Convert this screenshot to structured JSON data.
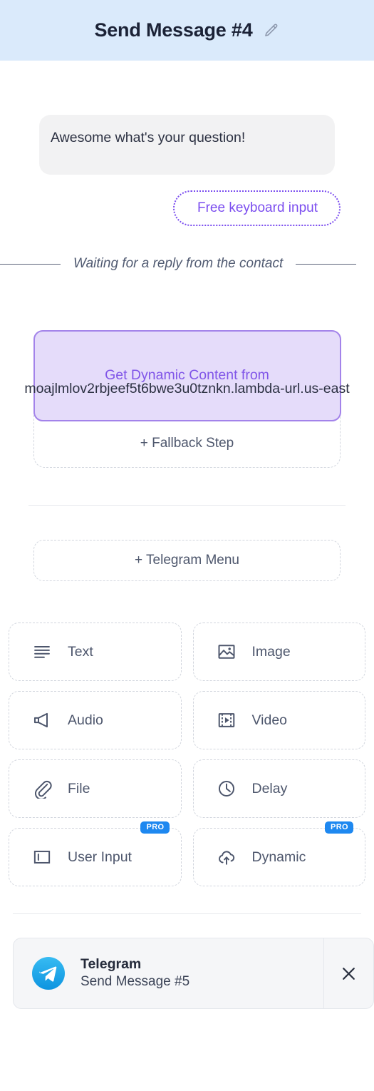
{
  "header": {
    "title": "Send Message #4",
    "edit_icon": "pencil-icon"
  },
  "conversation": {
    "message_text": "Awesome what's your question!",
    "keyboard_pill_label": "Free keyboard input",
    "waiting_divider_text": "Waiting for a reply from the contact"
  },
  "dynamic_card": {
    "title": "Get Dynamic Content from",
    "url": "https://moajlmlov2rbjeef5t6bwe3u0tznkn.lambda-url.us-east-1.on.aws/",
    "url_visible": "moajlmlov2rbjeef5t6bwe3u0tznkn.lambda-url.us-east",
    "fallback_label": "+ Fallback Step",
    "fill_color": "#e5dcfa",
    "border_color": "#a383ea",
    "text_color": "#8055e8"
  },
  "telegram_menu": {
    "label": "+ Telegram Menu"
  },
  "action_grid": {
    "items": [
      {
        "label": "Text",
        "icon": "text-lines-icon",
        "pro": false
      },
      {
        "label": "Image",
        "icon": "image-icon",
        "pro": false
      },
      {
        "label": "Audio",
        "icon": "speaker-icon",
        "pro": false
      },
      {
        "label": "Video",
        "icon": "film-play-icon",
        "pro": false
      },
      {
        "label": "File",
        "icon": "paperclip-icon",
        "pro": false
      },
      {
        "label": "Delay",
        "icon": "clock-icon",
        "pro": false
      },
      {
        "label": "User Input",
        "icon": "text-cursor-box-icon",
        "pro": true
      },
      {
        "label": "Dynamic",
        "icon": "cloud-upload-icon",
        "pro": true
      }
    ],
    "pro_badge_label": "PRO",
    "pro_badge_color": "#1e88f0"
  },
  "node_card": {
    "platform": "Telegram",
    "step_name": "Send Message #5",
    "logo_icon": "telegram-logo-icon",
    "close_icon": "close-icon"
  }
}
